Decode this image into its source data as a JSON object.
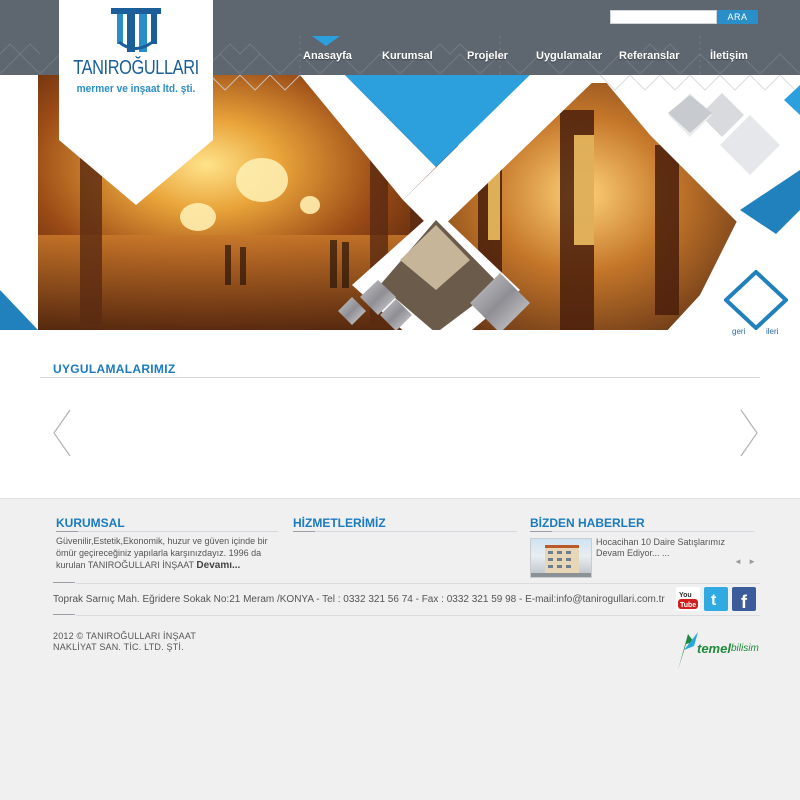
{
  "header": {
    "search": {
      "placeholder": "",
      "button_label": "ARA"
    },
    "nav": [
      {
        "label": "Anasayfa",
        "active": true
      },
      {
        "label": "Kurumsal"
      },
      {
        "label": "Projeler"
      },
      {
        "label": "Uygulamalar"
      },
      {
        "label": "Referanslar"
      },
      {
        "label": "İletişim"
      }
    ]
  },
  "logo": {
    "brand": "TANIROĞULLARI",
    "tagline": "mermer ve inşaat ltd. şti."
  },
  "slider": {
    "prev_label": "geri",
    "next_label": "ileri"
  },
  "applications": {
    "title": "UYGULAMALARIMIZ"
  },
  "footer": {
    "about": {
      "title": "KURUMSAL",
      "text": "Güvenilir,Estetik,Ekonomik, huzur ve güven içinde bir ömür geçireceğiniz yapılarla karşınızdayız. 1996 da kurulan TANIROĞULLARI İNŞAAT",
      "more": "Devamı..."
    },
    "services": {
      "title": "HİZMETLERİMİZ"
    },
    "news": {
      "title": "BİZDEN HABERLER",
      "item_text": "Hocacihan 10 Daire Satışlarımız Devam Ediyor... ...",
      "nav": "◄ ►"
    },
    "contact": "Toprak Sarnıç Mah. Eğridere Sokak No:21 Meram /KONYA - Tel : 0332 321 56 74 - Fax : 0332 321 59 98 - E-mail:info@tanirogullari.com.tr",
    "social": [
      {
        "name": "YouTube",
        "color": "#d0201e",
        "text": "You Tube"
      },
      {
        "name": "Twitter",
        "color": "#31a9e1",
        "text": "t"
      },
      {
        "name": "Facebook",
        "color": "#3b5b9b",
        "text": "f"
      }
    ],
    "copyright_line1": "2012 © TANIROĞULLARI İNŞAAT",
    "copyright_line2": "NAKLİYAT SAN. TİC. LTD. ŞTİ.",
    "credit_bold": "temel",
    "credit_light": "bilisim"
  },
  "colors": {
    "header_bg": "#5e6670",
    "accent_blue": "#2ba0dd",
    "title_blue": "#1b7bc0",
    "footer_bg": "#f0f0f0"
  }
}
